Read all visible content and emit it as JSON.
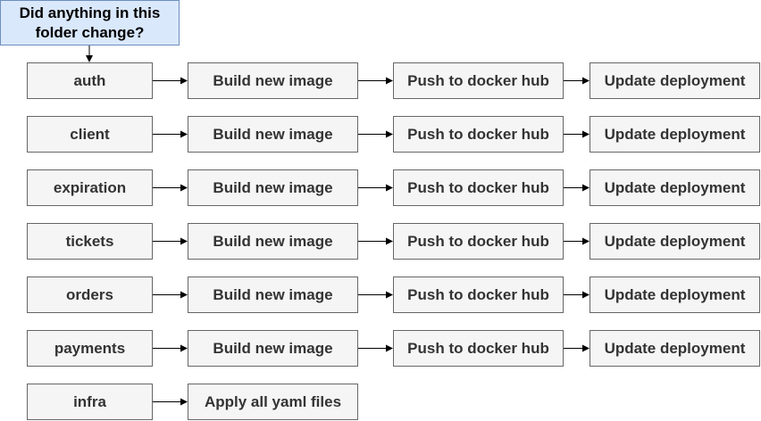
{
  "question": "Did anything in this folder change?",
  "step_labels": {
    "build": "Build new image",
    "push": "Push to docker hub",
    "update": "Update deployment",
    "apply": "Apply all yaml files"
  },
  "folders": [
    {
      "name": "auth",
      "pipeline": "full"
    },
    {
      "name": "client",
      "pipeline": "full"
    },
    {
      "name": "expiration",
      "pipeline": "full"
    },
    {
      "name": "tickets",
      "pipeline": "full"
    },
    {
      "name": "orders",
      "pipeline": "full"
    },
    {
      "name": "payments",
      "pipeline": "full"
    },
    {
      "name": "infra",
      "pipeline": "apply"
    }
  ],
  "colors": {
    "question_fill": "#dae8fc",
    "question_stroke": "#6c8ebf",
    "box_fill": "#f5f5f5",
    "box_stroke": "#666666",
    "text": "#333333"
  }
}
